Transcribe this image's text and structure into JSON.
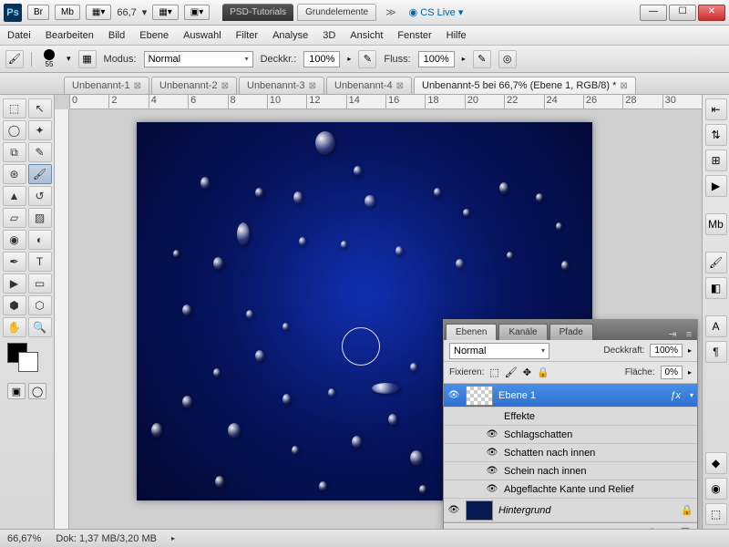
{
  "titlebar": {
    "app_abbrev": "Ps",
    "btns": [
      "Br",
      "Mb"
    ],
    "zoom": "66,7",
    "workspace_dark": "PSD-Tutorials",
    "workspace_light": "Grundelemente",
    "cslive": "CS Live"
  },
  "menu": [
    "Datei",
    "Bearbeiten",
    "Bild",
    "Ebene",
    "Auswahl",
    "Filter",
    "Analyse",
    "3D",
    "Ansicht",
    "Fenster",
    "Hilfe"
  ],
  "options": {
    "brush_size": "55",
    "modus_label": "Modus:",
    "modus_value": "Normal",
    "opacity_label": "Deckkr.:",
    "opacity_value": "100%",
    "flow_label": "Fluss:",
    "flow_value": "100%"
  },
  "doc_tabs": [
    {
      "label": "Unbenannt-1",
      "active": false
    },
    {
      "label": "Unbenannt-2",
      "active": false
    },
    {
      "label": "Unbenannt-3",
      "active": false
    },
    {
      "label": "Unbenannt-4",
      "active": false
    },
    {
      "label": "Unbenannt-5 bei 66,7% (Ebene 1, RGB/8) *",
      "active": true
    }
  ],
  "ruler_marks": [
    "0",
    "2",
    "4",
    "6",
    "8",
    "10",
    "12",
    "14",
    "16",
    "18",
    "20",
    "22",
    "24",
    "26",
    "28",
    "30"
  ],
  "layers_panel": {
    "tabs": [
      "Ebenen",
      "Kanäle",
      "Pfade"
    ],
    "blend_mode": "Normal",
    "opacity_label": "Deckkraft:",
    "opacity_value": "100%",
    "lock_label": "Fixieren:",
    "fill_label": "Fläche:",
    "fill_value": "0%",
    "layers": [
      {
        "name": "Ebene 1",
        "selected": true,
        "fx": true
      },
      {
        "name": "Effekte",
        "sub": true
      },
      {
        "name": "Schlagschatten",
        "sub": true,
        "eye": true
      },
      {
        "name": "Schatten nach innen",
        "sub": true,
        "eye": true
      },
      {
        "name": "Schein nach innen",
        "sub": true,
        "eye": true
      },
      {
        "name": "Abgeflachte Kante und Relief",
        "sub": true,
        "eye": true
      },
      {
        "name": "Hintergrund",
        "locked": true,
        "italic": true
      }
    ]
  },
  "status": {
    "zoom": "66,67%",
    "doc": "Dok: 1,37 MB/3,20 MB"
  },
  "drops": [
    [
      196,
      10,
      22,
      26
    ],
    [
      70,
      60,
      10,
      14
    ],
    [
      130,
      72,
      9,
      11
    ],
    [
      172,
      76,
      10,
      14
    ],
    [
      238,
      48,
      9,
      11
    ],
    [
      250,
      80,
      12,
      14
    ],
    [
      326,
      72,
      8,
      10
    ],
    [
      358,
      95,
      8,
      9
    ],
    [
      398,
      66,
      10,
      13
    ],
    [
      438,
      78,
      8,
      10
    ],
    [
      460,
      110,
      7,
      9
    ],
    [
      40,
      140,
      7,
      9
    ],
    [
      84,
      148,
      11,
      14
    ],
    [
      110,
      110,
      14,
      26
    ],
    [
      178,
      126,
      8,
      10
    ],
    [
      224,
      130,
      7,
      9
    ],
    [
      284,
      136,
      8,
      11
    ],
    [
      350,
      150,
      9,
      11
    ],
    [
      406,
      142,
      7,
      9
    ],
    [
      466,
      152,
      8,
      11
    ],
    [
      50,
      200,
      10,
      13
    ],
    [
      120,
      206,
      8,
      10
    ],
    [
      160,
      220,
      7,
      9
    ],
    [
      130,
      250,
      10,
      13
    ],
    [
      84,
      270,
      8,
      10
    ],
    [
      50,
      300,
      11,
      14
    ],
    [
      16,
      330,
      12,
      16
    ],
    [
      100,
      330,
      14,
      17
    ],
    [
      160,
      298,
      9,
      12
    ],
    [
      210,
      292,
      8,
      10
    ],
    [
      170,
      355,
      8,
      10
    ],
    [
      258,
      286,
      32,
      12
    ],
    [
      300,
      264,
      8,
      10
    ],
    [
      276,
      320,
      10,
      13
    ],
    [
      236,
      344,
      11,
      14
    ],
    [
      300,
      360,
      14,
      17
    ],
    [
      340,
      300,
      9,
      12
    ],
    [
      370,
      338,
      9,
      12
    ],
    [
      346,
      376,
      10,
      13
    ],
    [
      406,
      274,
      7,
      9
    ],
    [
      440,
      224,
      9,
      11
    ],
    [
      398,
      350,
      8,
      10
    ],
    [
      86,
      388,
      10,
      13
    ],
    [
      200,
      394,
      9,
      11
    ],
    [
      310,
      398,
      8,
      10
    ]
  ]
}
